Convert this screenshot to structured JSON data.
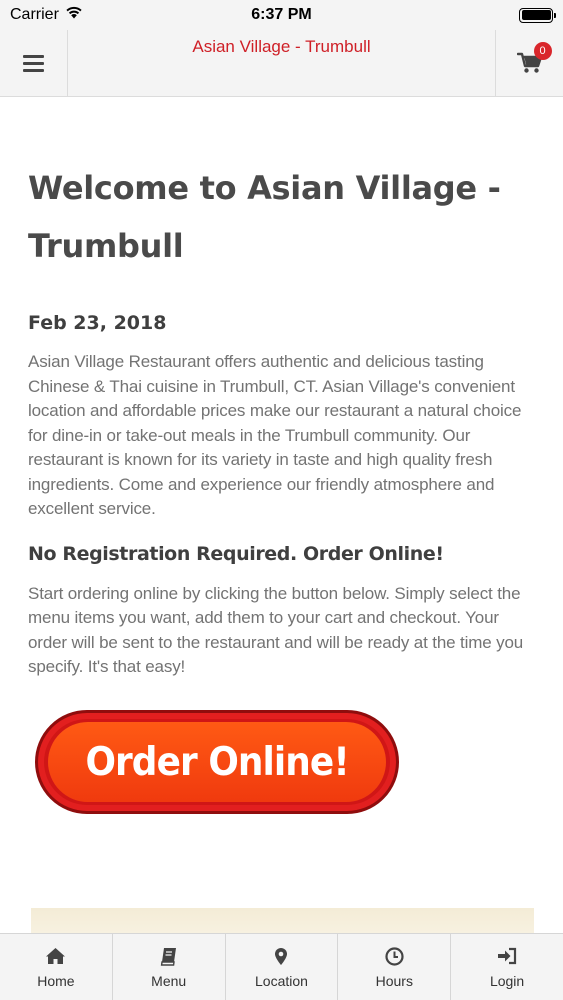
{
  "status_bar": {
    "carrier": "Carrier",
    "time": "6:37 PM"
  },
  "header": {
    "title": "Asian Village - Trumbull",
    "cart_count": "0"
  },
  "content": {
    "title": "Welcome to Asian Village - Trumbull",
    "date": "Feb 23, 2018",
    "intro": "Asian Village Restaurant offers authentic and delicious tasting Chinese & Thai cuisine in Trumbull, CT.  Asian Village's convenient location and affordable prices make our restaurant a natural choice for dine-in or take-out meals in the Trumbull community. Our restaurant is known for its variety in taste and high quality fresh ingredients. Come and experience our friendly atmosphere and excellent service.",
    "subheading": "No Registration Required. Order Online!",
    "instructions": "Start ordering online by clicking the button below. Simply select the menu items you want, add them to your cart and checkout. Your order will be sent to the restaurant and will be ready at the time you specify. It's that easy!",
    "order_button_label": "Order Online!"
  },
  "bottom_nav": [
    {
      "label": "Home",
      "icon": "home-icon"
    },
    {
      "label": "Menu",
      "icon": "book-icon"
    },
    {
      "label": "Location",
      "icon": "map-pin-icon"
    },
    {
      "label": "Hours",
      "icon": "clock-icon"
    },
    {
      "label": "Login",
      "icon": "login-icon"
    }
  ],
  "colors": {
    "accent": "#cf2027",
    "badge": "#d9262b",
    "order_button": "#f03a0e"
  }
}
